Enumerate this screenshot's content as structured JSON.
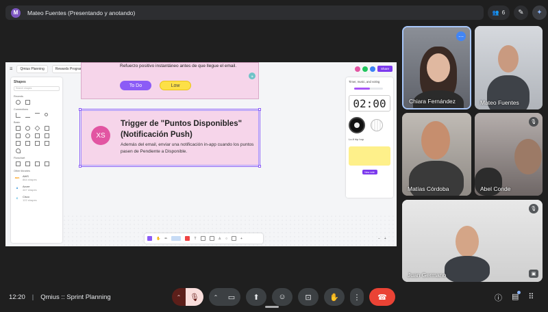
{
  "presenter": {
    "initial": "M",
    "title": "Mateo Fuentes (Presentando y anotando)"
  },
  "top_right": {
    "participant_count": "6"
  },
  "whiteboard": {
    "project": "Qmius Planning",
    "breadcrumb": "Rewards Program",
    "share_label": "Share",
    "shapes_panel": {
      "title": "Shapes",
      "search_placeholder": "Search shapes",
      "sections": [
        "Recents",
        "Connections",
        "Basic",
        "Flowchart",
        "Other libraries"
      ],
      "libraries": [
        {
          "logo": "aws",
          "name": "AWS",
          "count": "864 shapes",
          "color": "#ff9900"
        },
        {
          "logo": "A",
          "name": "Azure",
          "count": "447 shapes",
          "color": "#0078d4"
        },
        {
          "logo": "C",
          "name": "Cisco",
          "count": "122 shapes",
          "color": "#1ba0d7"
        }
      ]
    },
    "card1": {
      "text": "Refuerzo positivo instantáneo antes de que llegue el email.",
      "status_label": "To Do",
      "priority_label": "Low"
    },
    "card2": {
      "avatar_initials": "XS",
      "title": "Trigger de \"Puntos Disponibles\" (Notificación Push)",
      "body": "Además del email, enviar una notificación in-app cuando los puntos pasen de Pendiente a Disponible."
    },
    "timer_panel": {
      "title": "Timer, music, and voting",
      "clock": "02:00",
      "music_label": "Lo-fi hip hop",
      "new_vote_label": "New vote",
      "progress": 0.55
    }
  },
  "participants": [
    {
      "name": "Chiara Fernández",
      "muted": false,
      "speaking": true
    },
    {
      "name": "Mateo Fuentes",
      "muted": false,
      "speaking": false
    },
    {
      "name": "Matías Córdoba",
      "muted": false,
      "speaking": false
    },
    {
      "name": "Abel Conde",
      "muted": true,
      "speaking": false
    },
    {
      "name": "Juan Germano",
      "muted": true,
      "speaking": false
    }
  ],
  "meeting": {
    "time": "12:20",
    "title": "Qmius :: Sprint Planning"
  },
  "colors": {
    "accent": "#8ab4f8",
    "hangup": "#ea4335",
    "mic_off_bg": "#f9dedc",
    "brand_purple": "#8b5cf6",
    "card_pink": "#f6d5ea"
  }
}
